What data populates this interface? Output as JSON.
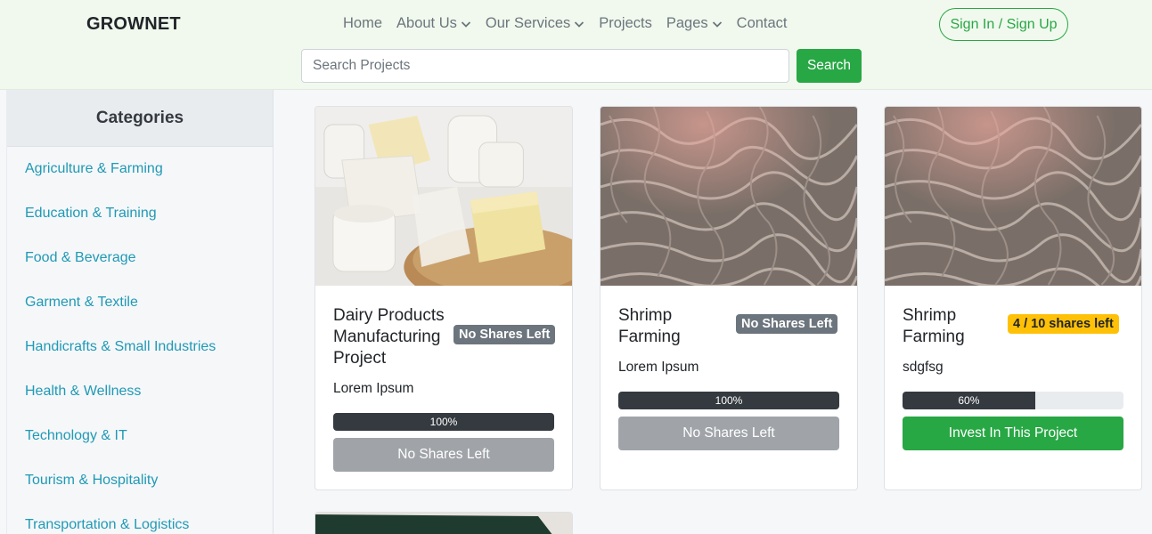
{
  "header": {
    "brand": "GROWNET",
    "nav": [
      {
        "label": "Home",
        "dropdown": false
      },
      {
        "label": "About Us",
        "dropdown": true
      },
      {
        "label": "Our Services",
        "dropdown": true
      },
      {
        "label": "Projects",
        "dropdown": false
      },
      {
        "label": "Pages",
        "dropdown": true
      },
      {
        "label": "Contact",
        "dropdown": false
      }
    ],
    "signin_label": "Sign In / Sign Up",
    "search_placeholder": "Search Projects",
    "search_button": "Search"
  },
  "sidebar": {
    "title": "Categories",
    "items": [
      {
        "label": "Agriculture & Farming"
      },
      {
        "label": "Education & Training"
      },
      {
        "label": "Food & Beverage"
      },
      {
        "label": "Garment & Textile"
      },
      {
        "label": "Handicrafts & Small Industries"
      },
      {
        "label": "Health & Wellness"
      },
      {
        "label": "Technology & IT"
      },
      {
        "label": "Tourism & Hospitality"
      },
      {
        "label": "Transportation & Logistics"
      }
    ]
  },
  "projects": [
    {
      "title": "Dairy Products Manufacturing Project",
      "badge": "No Shares Left",
      "badge_style": "gray",
      "description": "Lorem Ipsum",
      "progress_label": "100%",
      "progress": 1.0,
      "button": "No Shares Left",
      "button_style": "disabled",
      "image": "dairy-image"
    },
    {
      "title": "Shrimp Farming",
      "badge": "No Shares Left",
      "badge_style": "gray",
      "description": "Lorem Ipsum",
      "progress_label": "100%",
      "progress": 1.0,
      "button": "No Shares Left",
      "button_style": "disabled",
      "image": "shrimp-image"
    },
    {
      "title": "Shrimp Farming",
      "badge": "4 / 10 shares left",
      "badge_style": "yellow",
      "description": "sdgfsg",
      "progress_label": "60%",
      "progress": 0.6,
      "button": "Invest In This Project",
      "button_style": "success",
      "image": "shrimp-image"
    }
  ],
  "colors": {
    "accent": "#28a745",
    "link": "#1f9ab5",
    "header_bg": "#f1f9ee",
    "badge_gray": "#6c757d",
    "badge_yellow": "#ffc107",
    "progress": "#343a40"
  }
}
